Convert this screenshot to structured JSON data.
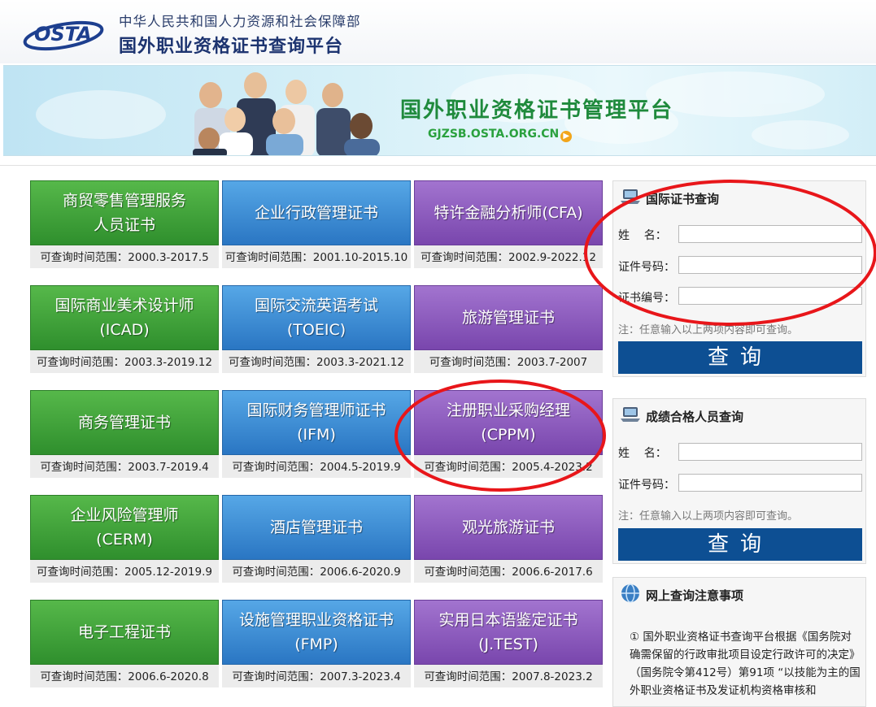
{
  "header": {
    "logo_text": "OSTA",
    "ministry": "中华人民共和国人力资源和社会保障部",
    "platform_title": "国外职业资格证书查询平台"
  },
  "banner": {
    "title": "国外职业资格证书管理平台",
    "url": "GJZSB.OSTA.ORG.CN"
  },
  "certificates": [
    {
      "name": "商贸零售管理服务\n人员证书",
      "range": "可查询时间范围：2000.3-2017.5",
      "color": "green"
    },
    {
      "name": "企业行政管理证书",
      "range": "可查询时间范围：2001.10-2015.10",
      "color": "blue"
    },
    {
      "name": "特许金融分析师(CFA)",
      "range": "可查询时间范围：2002.9-2022.12",
      "color": "purple"
    },
    {
      "name": "国际商业美术设计师\n(ICAD)",
      "range": "可查询时间范围：2003.3-2019.12",
      "color": "green"
    },
    {
      "name": "国际交流英语考试\n(TOEIC)",
      "range": "可查询时间范围：2003.3-2021.12",
      "color": "blue"
    },
    {
      "name": "旅游管理证书",
      "range": "可查询时间范围：2003.7-2007",
      "color": "purple"
    },
    {
      "name": "商务管理证书",
      "range": "可查询时间范围：2003.7-2019.4",
      "color": "green"
    },
    {
      "name": "国际财务管理师证书\n(IFM)",
      "range": "可查询时间范围：2004.5-2019.9",
      "color": "blue"
    },
    {
      "name": "注册职业采购经理\n(CPPM)",
      "range": "可查询时间范围：2005.4-2023.2",
      "color": "purple"
    },
    {
      "name": "企业风险管理师\n(CERM)",
      "range": "可查询时间范围：2005.12-2019.9",
      "color": "green"
    },
    {
      "name": "酒店管理证书",
      "range": "可查询时间范围：2006.6-2020.9",
      "color": "blue"
    },
    {
      "name": "观光旅游证书",
      "range": "可查询时间范围：2006.6-2017.6",
      "color": "purple"
    },
    {
      "name": "电子工程证书",
      "range": "可查询时间范围：2006.6-2020.8",
      "color": "green"
    },
    {
      "name": "设施管理职业资格证书\n(FMP)",
      "range": "可查询时间范围：2007.3-2023.4",
      "color": "blue"
    },
    {
      "name": "实用日本语鉴定证书\n(J.TEST)",
      "range": "可查询时间范围：2007.8-2023.2",
      "color": "purple"
    }
  ],
  "cert_query": {
    "title": "国际证书查询",
    "label_name": "姓    名：",
    "label_id": "证件号码：",
    "label_cert_no": "证书编号：",
    "value_name": "",
    "value_id": "",
    "value_cert_no": "",
    "note": "注：任意输入以上两项内容即可查询。",
    "button": "查询"
  },
  "score_query": {
    "title": "成绩合格人员查询",
    "label_name": "姓    名：",
    "label_id": "证件号码：",
    "value_name": "",
    "value_id": "",
    "note": "注：任意输入以上两项内容即可查询。",
    "button": "查询"
  },
  "notice": {
    "title": "网上查询注意事项",
    "body": "① 国外职业资格证书查询平台根据《国务院对确需保留的行政审批项目设定行政许可的决定》（国务院令第412号）第91项 “以技能为主的国外职业资格证书及发证机构资格审核和"
  },
  "colors": {
    "green": "#3a9e34",
    "blue": "#3b8fd6",
    "purple": "#8b5bbf",
    "button": "#0d4f93",
    "annotation": "#e8161a"
  }
}
